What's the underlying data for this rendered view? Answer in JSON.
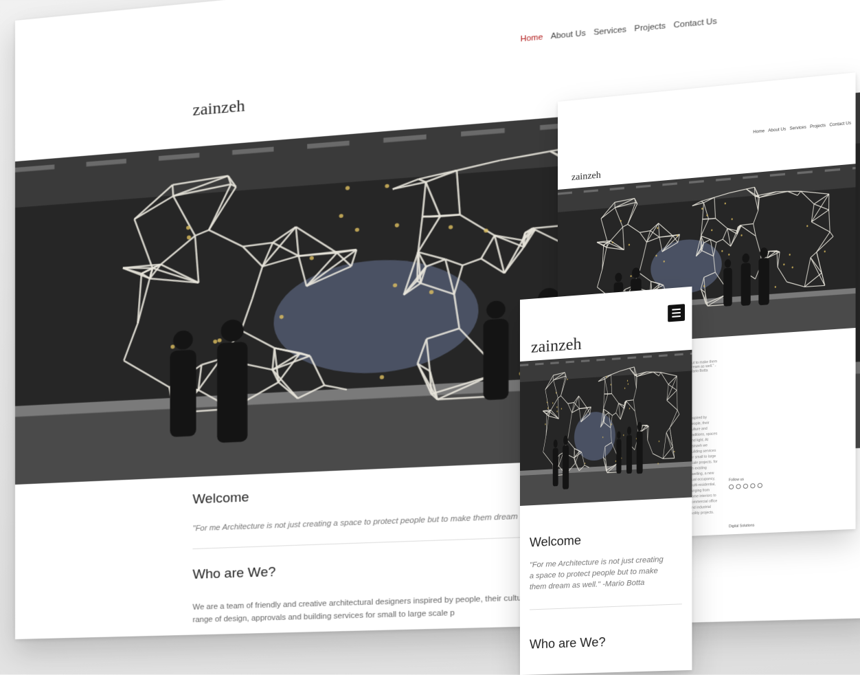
{
  "brand": {
    "logo": "zainzeh"
  },
  "nav": {
    "items": [
      {
        "label": "Home"
      },
      {
        "label": "About Us"
      },
      {
        "label": "Services"
      },
      {
        "label": "Projects"
      },
      {
        "label": "Contact Us"
      }
    ]
  },
  "welcome": {
    "heading": "Welcome",
    "quote": "\"For me Architecture is not just creating a space to protect people but to make them dream as well.\"",
    "mobile_quote": "\"For me Architecture is not just creating a space to protect people but to make them dream as well.\" -Mario Botta"
  },
  "about": {
    "heading": "Who are We?",
    "paragraph": "We are a team of friendly and creative architectural designers inspired by people, their culture and tr provide our clients diverse range of design, approvals and building services for small to large scale p"
  },
  "tablet": {
    "quote": "but to make them dream as well.\" -Mario Botta",
    "paragraph": "inspired by people, their culture and traditions, spaces and light. At zainzeh we building services for small to large scale projects. for an existing dwelling, a new dual occupancy, multi-residential, ranging from home interiors to commercial office and industrial facility projects.",
    "follow_label": "Follow us",
    "footer_note": "Digital Solutions"
  },
  "colors": {
    "accent": "#b32020",
    "menu_button": "#111111"
  },
  "icons": [
    "hamburger-menu-icon",
    "social-icon"
  ]
}
